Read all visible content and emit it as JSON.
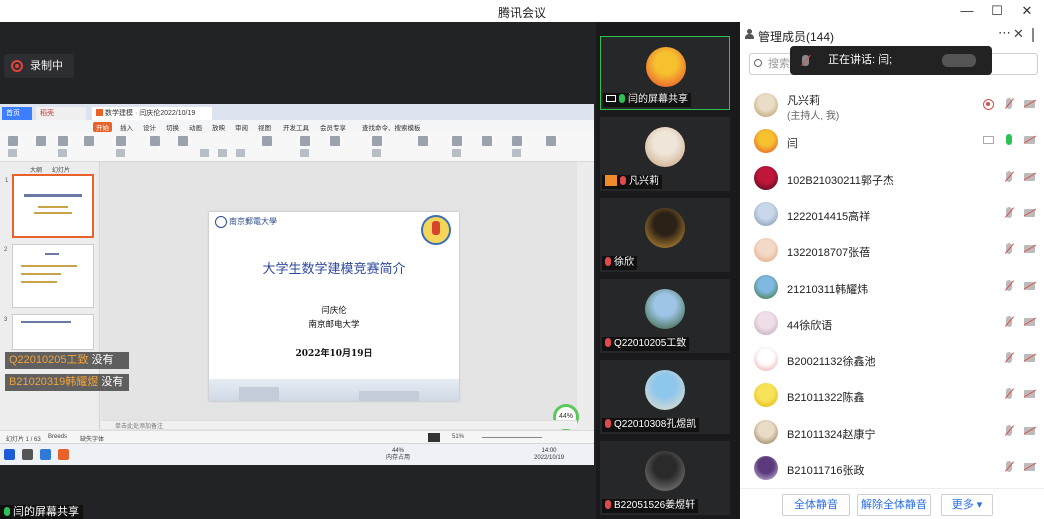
{
  "window": {
    "title": "腾讯会议",
    "minimize": "—",
    "maximize": "☐",
    "close": "✕"
  },
  "recording": {
    "label": "录制中"
  },
  "screen_share": {
    "label": "闫的屏幕共享",
    "wps": {
      "tabs": [
        "首页",
        "稻壳",
        "数学建模 · 闫庆伦2022/10/19"
      ],
      "menus": [
        "开始",
        "插入",
        "设计",
        "切换",
        "动画",
        "放映",
        "审阅",
        "视图",
        "开发工具",
        "会员专享"
      ],
      "search": "查找命令、搜索模板",
      "panel_tabs": [
        "大纲",
        "幻灯片"
      ],
      "slide": {
        "logo_text": "南京郵電大學",
        "title": "大学生数学建模竞赛简介",
        "author": "闫庆伦",
        "org": "南京邮电大学",
        "date": "2022年10月19日"
      },
      "zoom_badge": "44%",
      "notes": "单击此处添加备注",
      "status": {
        "page": "幻灯片 1 / 63",
        "theme": "Breeds",
        "font": "缺失字体",
        "zoom": "51%"
      },
      "taskbar": {
        "cpu": "44%",
        "cpu_label": "内存占用",
        "time": "14:00",
        "date": "2022/10/19"
      }
    },
    "speaking": [
      {
        "name": "Q22010205工致",
        "suffix": "没有"
      },
      {
        "name": "B21020319韩耀煜",
        "suffix": "没有"
      }
    ]
  },
  "videos": [
    {
      "label": "闫的屏幕共享",
      "mic": "on",
      "screen": true,
      "colors": [
        "#f5c12e",
        "#e8452f"
      ]
    },
    {
      "label": "凡兴莉",
      "mic": "muted",
      "host": true,
      "colors": [
        "#efe6da",
        "#c7a07a"
      ]
    },
    {
      "label": "徐欣",
      "mic": "muted",
      "colors": [
        "#2a2016",
        "#d49a3a"
      ]
    },
    {
      "label": "Q22010205工致",
      "mic": "muted",
      "colors": [
        "#9ec4e6",
        "#2e5a2a"
      ]
    },
    {
      "label": "Q22010308孔煜凯",
      "mic": "muted",
      "colors": [
        "#8fc6ec",
        "#e9e2c9"
      ]
    },
    {
      "label": "B22051526姜煜轩",
      "mic": "muted",
      "colors": [
        "#2a2a2a",
        "#8a8a8a"
      ]
    }
  ],
  "members": {
    "title": "管理成员(144)",
    "search_placeholder": "搜索成员",
    "talking": "正在讲话: 闫;",
    "list": [
      {
        "name": "凡兴莉",
        "role": "(主持人, 我)",
        "rec": true,
        "mic": "off",
        "colors": [
          "#e9ddc8",
          "#b8945c"
        ]
      },
      {
        "name": "闫",
        "mic": "on",
        "screen": true,
        "colors": [
          "#f5c12e",
          "#e8452f"
        ]
      },
      {
        "name": "102B21030211郭子杰",
        "mic": "off",
        "colors": [
          "#c0163a",
          "#3a0b1a"
        ]
      },
      {
        "name": "1222014415高祥",
        "mic": "off",
        "colors": [
          "#c8d8ea",
          "#7a8aa6"
        ]
      },
      {
        "name": "1322018707张蓓",
        "mic": "off",
        "colors": [
          "#f3d9c8",
          "#e0a27a"
        ]
      },
      {
        "name": "21210311韩耀炜",
        "mic": "off",
        "colors": [
          "#7fb8e0",
          "#3a6a2a"
        ]
      },
      {
        "name": "44徐欣语",
        "mic": "off",
        "colors": [
          "#efdfe8",
          "#b9a2b2"
        ]
      },
      {
        "name": "B20021132徐鑫池",
        "mic": "off",
        "colors": [
          "#ffffff",
          "#e9a1a1"
        ]
      },
      {
        "name": "B21011322陈鑫",
        "mic": "off",
        "colors": [
          "#f7e35a",
          "#e2b300"
        ]
      },
      {
        "name": "B21011324赵康宁",
        "mic": "off",
        "colors": [
          "#e9dcc6",
          "#8a6a4a"
        ]
      },
      {
        "name": "B21011716张政",
        "mic": "off",
        "colors": [
          "#5a3a7a",
          "#d7c2e6"
        ]
      }
    ],
    "buttons": {
      "mute_all": "全体静音",
      "unmute_all": "解除全体静音",
      "more": "更多 ▾"
    }
  }
}
